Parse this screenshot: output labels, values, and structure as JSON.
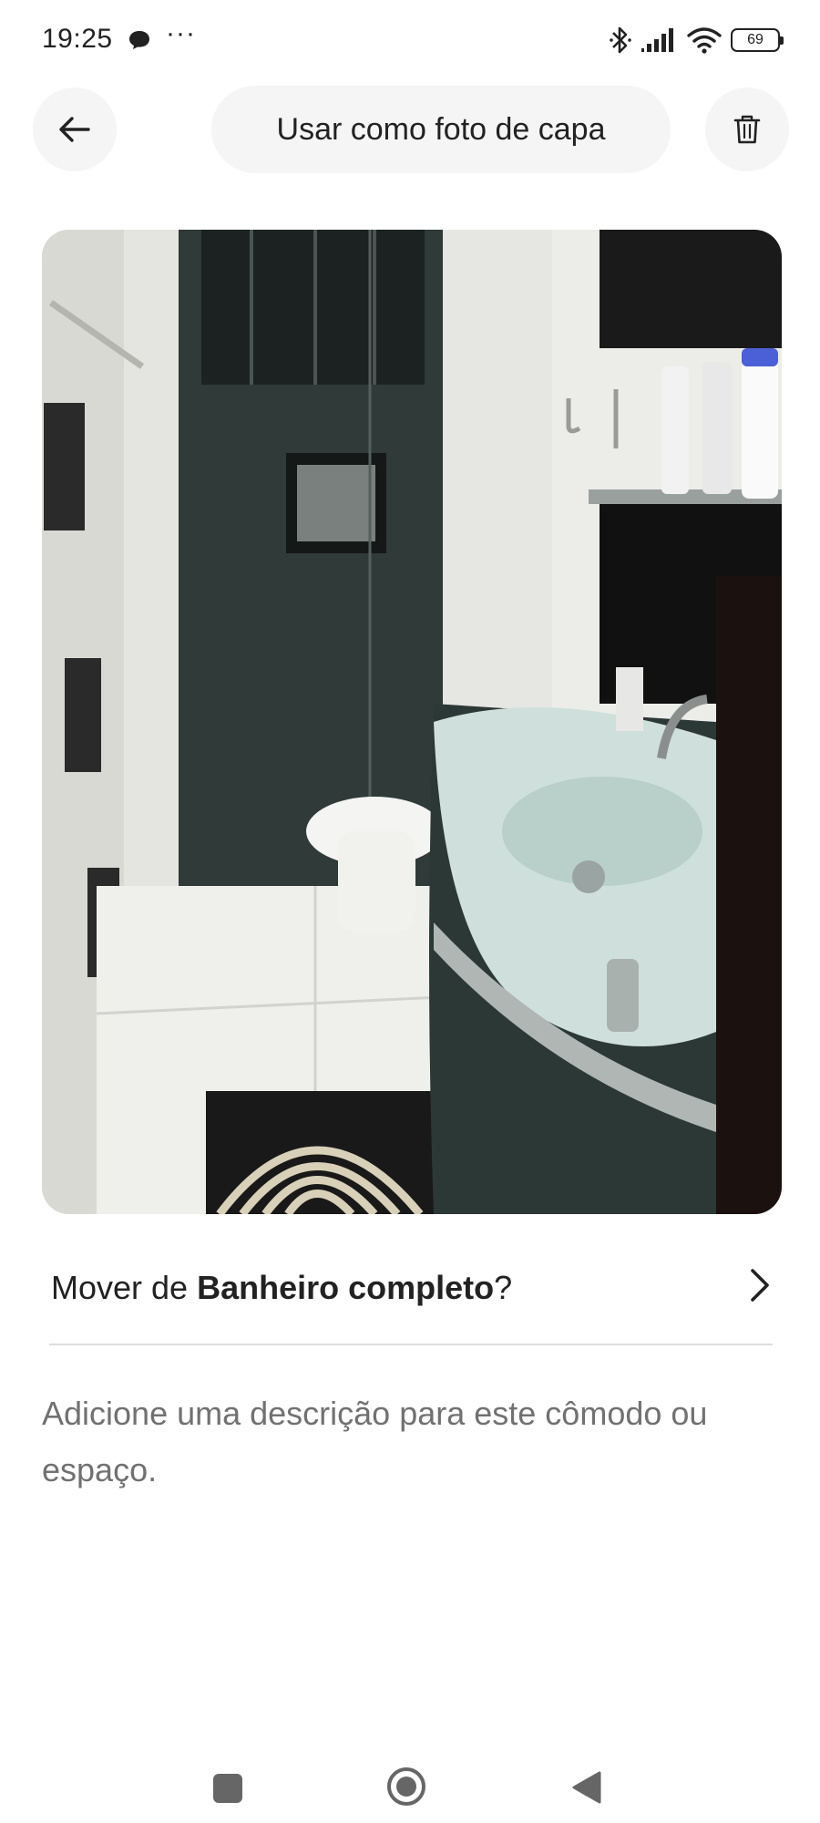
{
  "status_bar": {
    "time": "19:25",
    "more": "···",
    "battery": "69"
  },
  "header": {
    "cover_button_label": "Usar como foto de capa"
  },
  "photo": {
    "subject": "bathroom-photo"
  },
  "move_row": {
    "prefix": "Mover de ",
    "room": "Banheiro completo",
    "suffix": "?"
  },
  "description": {
    "placeholder": "Adicione uma descrição para este cômodo ou espaço."
  },
  "icons": {
    "back": "arrow-left-icon",
    "delete": "trash-icon",
    "chevron": "chevron-right-icon",
    "nav_recents": "square-icon",
    "nav_home": "circle-icon",
    "nav_back": "triangle-back-icon"
  }
}
